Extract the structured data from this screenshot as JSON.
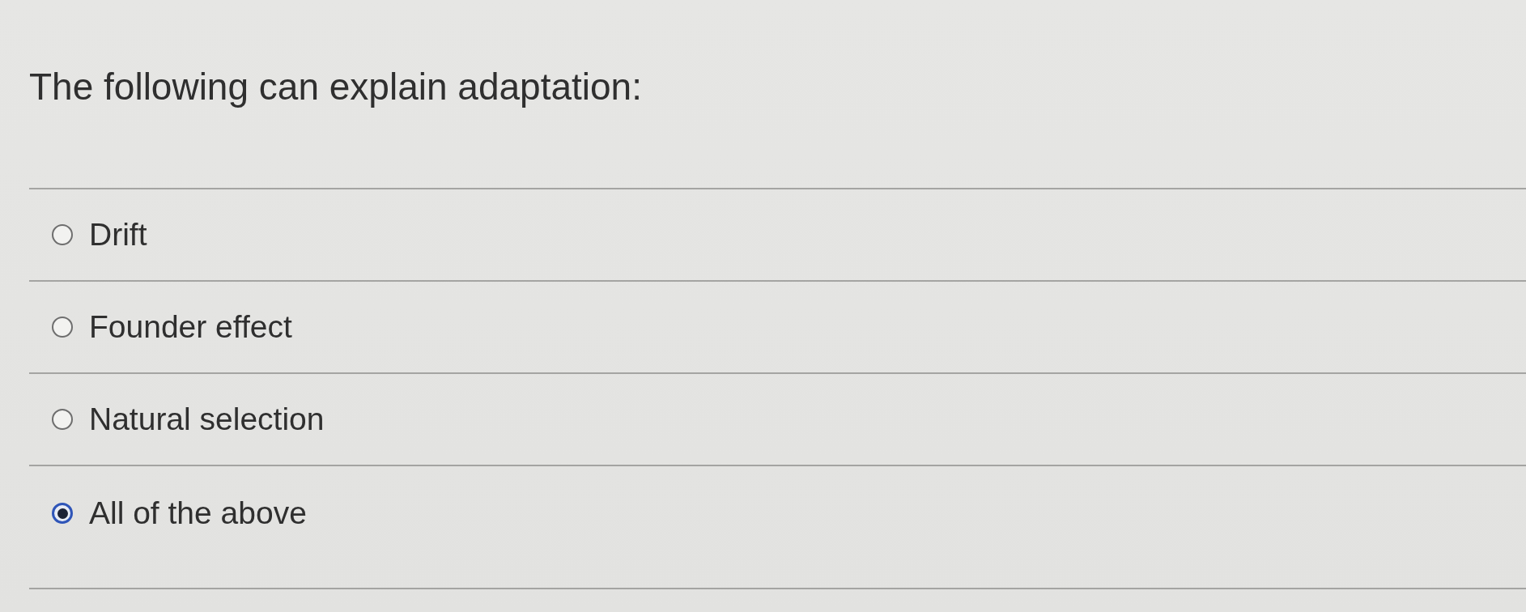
{
  "question": {
    "text": "The following can explain adaptation:"
  },
  "options": [
    {
      "label": "Drift",
      "selected": false
    },
    {
      "label": "Founder effect",
      "selected": false
    },
    {
      "label": "Natural selection",
      "selected": false
    },
    {
      "label": "All of the above",
      "selected": true
    }
  ]
}
